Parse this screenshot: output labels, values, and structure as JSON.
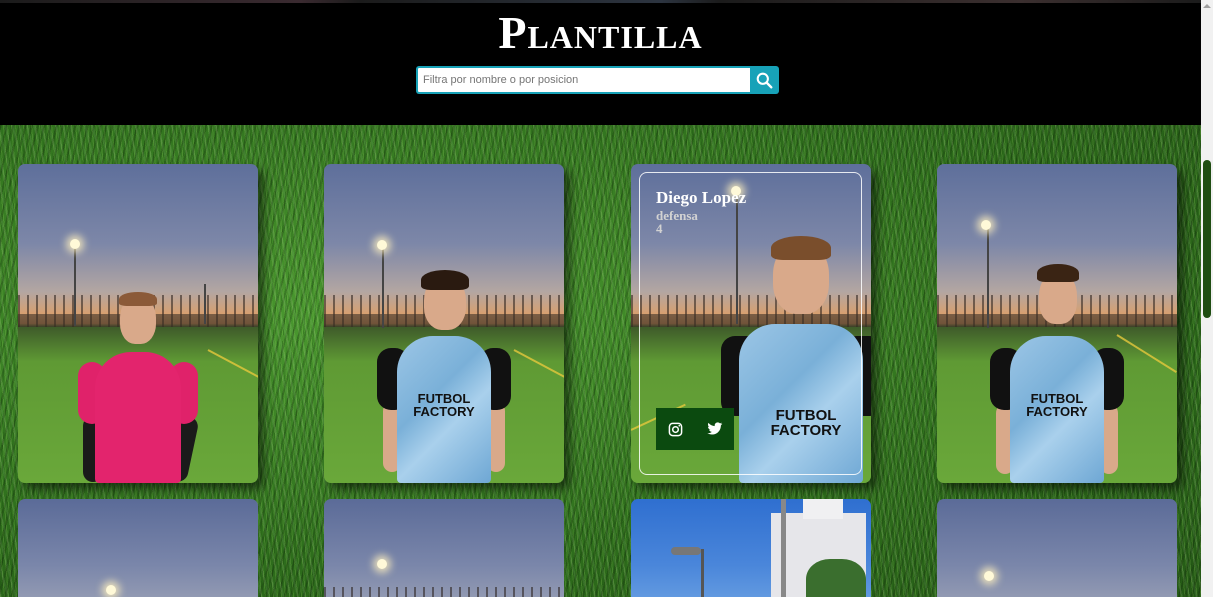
{
  "header": {
    "title": "Plantilla",
    "search_placeholder": "Filtra por nombre o por posicion",
    "search_value": ""
  },
  "featured_player": {
    "name": "Diego Lopez",
    "position": "defensa",
    "number": "4"
  },
  "colors": {
    "header_bg": "#000000",
    "accent": "#17a2b8",
    "social_bg": "#0b4a0f",
    "grass": "#347a22"
  },
  "icons": {
    "search": "magnifier",
    "instagram": "instagram",
    "twitter": "twitter-bird"
  }
}
